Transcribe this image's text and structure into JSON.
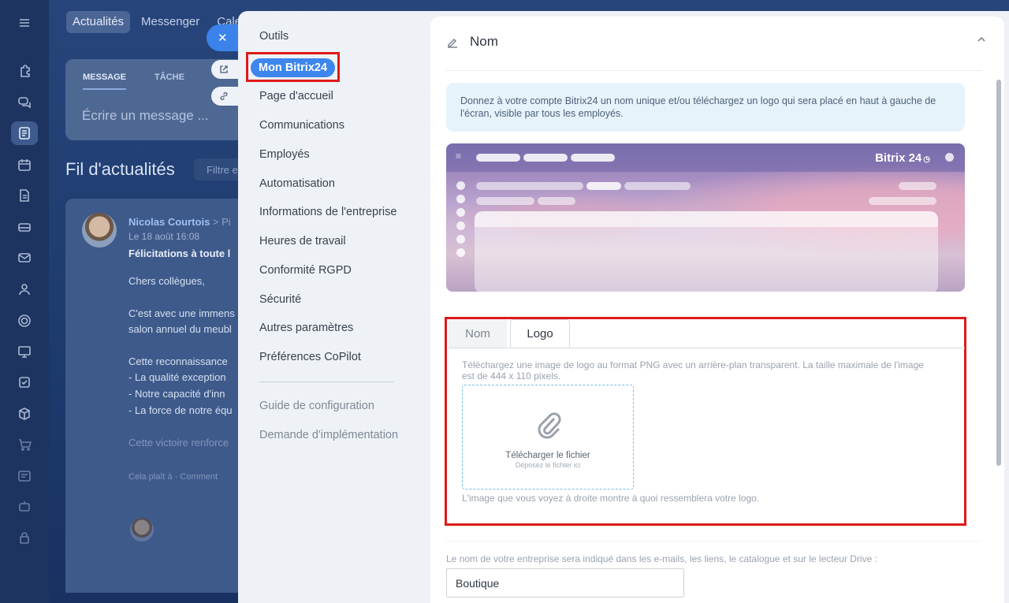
{
  "background": {
    "topnav": [
      "Actualités",
      "Messenger",
      "Cale"
    ],
    "composer": {
      "tabs": [
        "MESSAGE",
        "TÂCHE"
      ],
      "placeholder": "Écrire un message ..."
    },
    "feed_title": "Fil d'actualités",
    "feed_filter": "Filtre e",
    "post": {
      "author": "Nicolas Courtois",
      "author_suffix": "> Pi",
      "date": "Le 18 août 16:08",
      "subject": "Félicitations à toute l",
      "lines": [
        "Chers collègues,",
        "C'est avec une immens",
        "salon annuel du meubl",
        "Cette reconnaissance",
        "- La qualité exception",
        "- Notre capacité d'inn",
        "- La force de notre équ",
        "Cette victoire renforce",
        "Cela plaît à · Comment"
      ]
    },
    "close_symbol": "✕"
  },
  "menu": {
    "items": [
      "Outils",
      "Mon Bitrix24",
      "Page d'accueil",
      "Communications",
      "Employés",
      "Automatisation",
      "Informations de l'entreprise",
      "Heures de travail",
      "Conformité RGPD",
      "Sécurité",
      "Autres paramètres",
      "Préférences CoPilot"
    ],
    "secondary": [
      "Guide de configuration",
      "Demande d'implémentation"
    ],
    "selected": "Mon Bitrix24"
  },
  "section": {
    "title": "Nom",
    "info": "Donnez à votre compte Bitrix24 un nom unique et/ou téléchargez un logo qui sera placé en haut à gauche de l'écran, visible par tous les employés.",
    "preview_brand": "Bitrix 24",
    "preview_brand_mark": "◷",
    "tabs": [
      "Nom",
      "Logo"
    ],
    "active_tab": "Logo",
    "logo_description": "Téléchargez une image de logo au format PNG avec un arrière-plan transparent. La taille maximale de l'image est de 444 x 110 pixels.",
    "upload_title": "Télécharger le fichier",
    "upload_subtitle": "Déposez le fichier ici",
    "logo_hint": "L'image que vous voyez à droite montre à quoi ressemblera votre logo.",
    "company_label": "Le nom de votre entreprise sera indiqué dans les e-mails, les liens, le catalogue et sur le lecteur Drive :",
    "company_value": "Boutique"
  },
  "colors": {
    "accent": "#3d86ee",
    "highlight": "#e01919"
  }
}
